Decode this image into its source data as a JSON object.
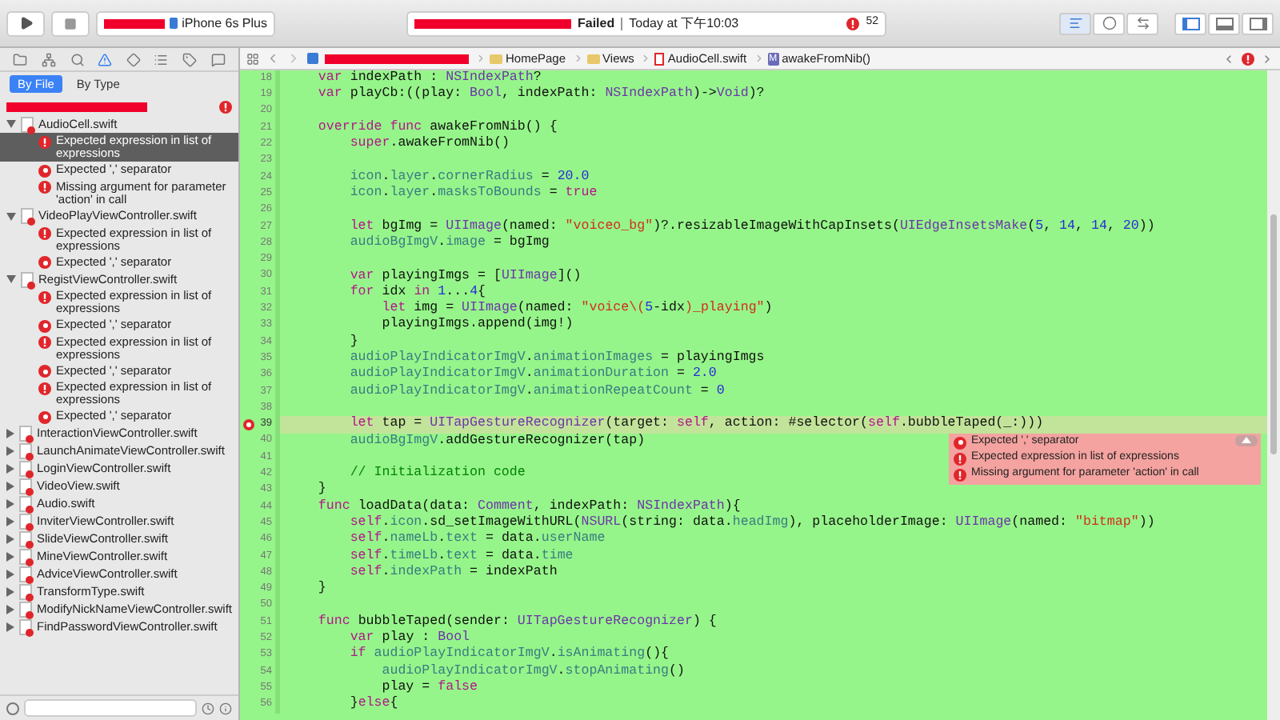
{
  "toolbar": {
    "device": "iPhone 6s Plus",
    "status": "Failed",
    "time": "Today at 下午10:03",
    "error_count": "52",
    "editor_modes": [
      {
        "selected": true
      },
      {
        "selected": false
      },
      {
        "selected": false
      }
    ],
    "panels": [
      {
        "selected": true
      },
      {
        "selected": false
      },
      {
        "selected": false
      }
    ]
  },
  "navigator": {
    "icon_tabs": [
      {
        "kind": "folder",
        "selected": false
      },
      {
        "kind": "hierarchy",
        "selected": false
      },
      {
        "kind": "search",
        "selected": false
      },
      {
        "kind": "warning",
        "selected": true
      },
      {
        "kind": "diamond",
        "selected": false
      },
      {
        "kind": "list",
        "selected": false
      },
      {
        "kind": "tag",
        "selected": false
      },
      {
        "kind": "bubble",
        "selected": false
      }
    ],
    "tabs": [
      {
        "label": "By File",
        "selected": true
      },
      {
        "label": "By Type",
        "selected": false
      }
    ],
    "files": [
      {
        "name": "AudioCell.swift",
        "expanded": true,
        "issues": [
          {
            "kind": "error",
            "text": "Expected expression in list of expressions",
            "selected": true
          },
          {
            "kind": "fixit",
            "text": "Expected ',' separator",
            "selected": false
          },
          {
            "kind": "error",
            "text": "Missing argument for parameter 'action' in call",
            "selected": false
          }
        ]
      },
      {
        "name": "VideoPlayViewController.swift",
        "expanded": true,
        "issues": [
          {
            "kind": "error",
            "text": "Expected expression in list of expressions",
            "selected": false
          },
          {
            "kind": "fixit",
            "text": "Expected ',' separator",
            "selected": false
          }
        ]
      },
      {
        "name": "RegistViewController.swift",
        "expanded": true,
        "issues": [
          {
            "kind": "error",
            "text": "Expected expression in list of expressions",
            "selected": false
          },
          {
            "kind": "fixit",
            "text": "Expected ',' separator",
            "selected": false
          },
          {
            "kind": "error",
            "text": "Expected expression in list of expressions",
            "selected": false
          },
          {
            "kind": "fixit",
            "text": "Expected ',' separator",
            "selected": false
          },
          {
            "kind": "error",
            "text": "Expected expression in list of expressions",
            "selected": false
          },
          {
            "kind": "fixit",
            "text": "Expected ',' separator",
            "selected": false
          }
        ]
      },
      {
        "name": "InteractionViewController.swift",
        "expanded": false
      },
      {
        "name": "LaunchAnimateViewController.swift",
        "expanded": false
      },
      {
        "name": "LoginViewController.swift",
        "expanded": false
      },
      {
        "name": "VideoView.swift",
        "expanded": false
      },
      {
        "name": "Audio.swift",
        "expanded": false
      },
      {
        "name": "InviterViewController.swift",
        "expanded": false
      },
      {
        "name": "SlideViewController.swift",
        "expanded": false
      },
      {
        "name": "MineViewController.swift",
        "expanded": false
      },
      {
        "name": "AdviceViewController.swift",
        "expanded": false
      },
      {
        "name": "TransformType.swift",
        "expanded": false
      },
      {
        "name": "ModifyNickNameViewController.swift",
        "expanded": false
      },
      {
        "name": "FindPasswordViewController.swift",
        "expanded": false
      }
    ]
  },
  "jump_bar": [
    {
      "kind": "folder",
      "label": "HomePage"
    },
    {
      "kind": "folder",
      "label": "Views"
    },
    {
      "kind": "file",
      "label": "AudioCell.swift"
    },
    {
      "kind": "method",
      "badge": "M",
      "label": "awakeFromNib()"
    }
  ],
  "editor": {
    "lines": [
      {
        "n": "18",
        "error": false,
        "tokens": [
          {
            "kind": "k",
            "text": "    var"
          },
          {
            "kind": "x",
            "text": " indexPath : "
          },
          {
            "kind": "t",
            "text": "NSIndexPath"
          },
          {
            "kind": "x",
            "text": "?"
          }
        ]
      },
      {
        "n": "19",
        "error": false,
        "tokens": [
          {
            "kind": "k",
            "text": "    var"
          },
          {
            "kind": "x",
            "text": " playCb:((play: "
          },
          {
            "kind": "t",
            "text": "Bool"
          },
          {
            "kind": "x",
            "text": ", indexPath: "
          },
          {
            "kind": "t",
            "text": "NSIndexPath"
          },
          {
            "kind": "x",
            "text": ")->"
          },
          {
            "kind": "t",
            "text": "Void"
          },
          {
            "kind": "x",
            "text": ")?"
          }
        ]
      },
      {
        "n": "20",
        "error": false
      },
      {
        "n": "21",
        "error": false,
        "tokens": [
          {
            "kind": "k",
            "text": "    override func"
          },
          {
            "kind": "x",
            "text": " awakeFromNib() {"
          }
        ]
      },
      {
        "n": "22",
        "error": false,
        "tokens": [
          {
            "kind": "k",
            "text": "        super"
          },
          {
            "kind": "x",
            "text": ".awakeFromNib()"
          }
        ]
      },
      {
        "n": "23",
        "error": false
      },
      {
        "n": "24",
        "error": false,
        "tokens": [
          {
            "kind": "p",
            "text": "        icon"
          },
          {
            "kind": "x",
            "text": "."
          },
          {
            "kind": "p",
            "text": "layer"
          },
          {
            "kind": "x",
            "text": "."
          },
          {
            "kind": "p",
            "text": "cornerRadius"
          },
          {
            "kind": "x",
            "text": " = "
          },
          {
            "kind": "n",
            "text": "20.0"
          }
        ]
      },
      {
        "n": "25",
        "error": false,
        "tokens": [
          {
            "kind": "p",
            "text": "        icon"
          },
          {
            "kind": "x",
            "text": "."
          },
          {
            "kind": "p",
            "text": "layer"
          },
          {
            "kind": "x",
            "text": "."
          },
          {
            "kind": "p",
            "text": "masksToBounds"
          },
          {
            "kind": "x",
            "text": " = "
          },
          {
            "kind": "k",
            "text": "true"
          }
        ]
      },
      {
        "n": "26",
        "error": false
      },
      {
        "n": "27",
        "error": false,
        "tokens": [
          {
            "kind": "k",
            "text": "        let"
          },
          {
            "kind": "x",
            "text": " bgImg = "
          },
          {
            "kind": "t",
            "text": "UIImage"
          },
          {
            "kind": "x",
            "text": "(named: "
          },
          {
            "kind": "s",
            "text": "\"voiceo_bg\""
          },
          {
            "kind": "x",
            "text": ")?.resizableImageWithCapInsets("
          },
          {
            "kind": "t",
            "text": "UIEdgeInsetsMake"
          },
          {
            "kind": "x",
            "text": "("
          },
          {
            "kind": "n",
            "text": "5"
          },
          {
            "kind": "x",
            "text": ", "
          },
          {
            "kind": "n",
            "text": "14"
          },
          {
            "kind": "x",
            "text": ", "
          },
          {
            "kind": "n",
            "text": "14"
          },
          {
            "kind": "x",
            "text": ", "
          },
          {
            "kind": "n",
            "text": "20"
          },
          {
            "kind": "x",
            "text": "))"
          }
        ]
      },
      {
        "n": "28",
        "error": false,
        "tokens": [
          {
            "kind": "p",
            "text": "        audioBgImgV"
          },
          {
            "kind": "x",
            "text": "."
          },
          {
            "kind": "p",
            "text": "image"
          },
          {
            "kind": "x",
            "text": " = bgImg"
          }
        ]
      },
      {
        "n": "29",
        "error": false
      },
      {
        "n": "30",
        "error": false,
        "tokens": [
          {
            "kind": "k",
            "text": "        var"
          },
          {
            "kind": "x",
            "text": " playingImgs = ["
          },
          {
            "kind": "t",
            "text": "UIImage"
          },
          {
            "kind": "x",
            "text": "]()"
          }
        ]
      },
      {
        "n": "31",
        "error": false,
        "tokens": [
          {
            "kind": "k",
            "text": "        for"
          },
          {
            "kind": "x",
            "text": " idx "
          },
          {
            "kind": "k",
            "text": "in"
          },
          {
            "kind": "n",
            "text": " 1"
          },
          {
            "kind": "x",
            "text": "..."
          },
          {
            "kind": "n",
            "text": "4"
          },
          {
            "kind": "x",
            "text": "{"
          }
        ]
      },
      {
        "n": "32",
        "error": false,
        "tokens": [
          {
            "kind": "k",
            "text": "            let"
          },
          {
            "kind": "x",
            "text": " img = "
          },
          {
            "kind": "t",
            "text": "UIImage"
          },
          {
            "kind": "x",
            "text": "(named: "
          },
          {
            "kind": "s",
            "text": "\"voice\\("
          },
          {
            "kind": "n",
            "text": "5"
          },
          {
            "kind": "x",
            "text": "-idx"
          },
          {
            "kind": "s",
            "text": ")_playing\""
          },
          {
            "kind": "x",
            "text": ")"
          }
        ]
      },
      {
        "n": "33",
        "error": false,
        "tokens": [
          {
            "kind": "x",
            "text": "            playingImgs.append(img!)"
          }
        ]
      },
      {
        "n": "34",
        "error": false,
        "tokens": [
          {
            "kind": "x",
            "text": "        }"
          }
        ]
      },
      {
        "n": "35",
        "error": false,
        "tokens": [
          {
            "kind": "p",
            "text": "        audioPlayIndicatorImgV"
          },
          {
            "kind": "x",
            "text": "."
          },
          {
            "kind": "p",
            "text": "animationImages"
          },
          {
            "kind": "x",
            "text": " = playingImgs"
          }
        ]
      },
      {
        "n": "36",
        "error": false,
        "tokens": [
          {
            "kind": "p",
            "text": "        audioPlayIndicatorImgV"
          },
          {
            "kind": "x",
            "text": "."
          },
          {
            "kind": "p",
            "text": "animationDuration"
          },
          {
            "kind": "x",
            "text": " = "
          },
          {
            "kind": "n",
            "text": "2.0"
          }
        ]
      },
      {
        "n": "37",
        "error": false,
        "tokens": [
          {
            "kind": "p",
            "text": "        audioPlayIndicatorImgV"
          },
          {
            "kind": "x",
            "text": "."
          },
          {
            "kind": "p",
            "text": "animationRepeatCount"
          },
          {
            "kind": "x",
            "text": " = "
          },
          {
            "kind": "n",
            "text": "0"
          }
        ]
      },
      {
        "n": "38",
        "error": false
      },
      {
        "n": "39",
        "error": true,
        "tokens": [
          {
            "kind": "k",
            "text": "        let"
          },
          {
            "kind": "x",
            "text": " tap = "
          },
          {
            "kind": "t",
            "text": "UITapGestureRecognizer"
          },
          {
            "kind": "x",
            "text": "(target: "
          },
          {
            "kind": "k",
            "text": "self"
          },
          {
            "kind": "x",
            "text": ", action: #selector("
          },
          {
            "kind": "k",
            "text": "self"
          },
          {
            "kind": "x",
            "text": ".bubbleTaped(_:)))"
          }
        ],
        "issues": [
          {
            "kind": "fixit",
            "text": "Expected ',' separator"
          },
          {
            "kind": "error",
            "text": "Expected expression in list of expressions"
          },
          {
            "kind": "error",
            "text": "Missing argument for parameter 'action' in call"
          }
        ]
      },
      {
        "n": "40",
        "error": false,
        "tokens": [
          {
            "kind": "p",
            "text": "        audioBgImgV"
          },
          {
            "kind": "x",
            "text": ".addGestureRecognizer(tap)"
          }
        ]
      },
      {
        "n": "41",
        "error": false
      },
      {
        "n": "42",
        "error": false,
        "tokens": [
          {
            "kind": "c",
            "text": "        // Initialization code"
          }
        ]
      },
      {
        "n": "43",
        "error": false,
        "tokens": [
          {
            "kind": "x",
            "text": "    }"
          }
        ]
      },
      {
        "n": "44",
        "error": false,
        "tokens": [
          {
            "kind": "k",
            "text": "    func"
          },
          {
            "kind": "x",
            "text": " loadData(data: "
          },
          {
            "kind": "t",
            "text": "Comment"
          },
          {
            "kind": "x",
            "text": ", indexPath: "
          },
          {
            "kind": "t",
            "text": "NSIndexPath"
          },
          {
            "kind": "x",
            "text": "){"
          }
        ]
      },
      {
        "n": "45",
        "error": false,
        "tokens": [
          {
            "kind": "k",
            "text": "        self"
          },
          {
            "kind": "x",
            "text": "."
          },
          {
            "kind": "p",
            "text": "icon"
          },
          {
            "kind": "x",
            "text": ".sd_setImageWithURL("
          },
          {
            "kind": "t",
            "text": "NSURL"
          },
          {
            "kind": "x",
            "text": "(string: data."
          },
          {
            "kind": "p",
            "text": "headImg"
          },
          {
            "kind": "x",
            "text": "), placeholderImage: "
          },
          {
            "kind": "t",
            "text": "UIImage"
          },
          {
            "kind": "x",
            "text": "(named: "
          },
          {
            "kind": "s",
            "text": "\"bitmap\""
          },
          {
            "kind": "x",
            "text": "))"
          }
        ]
      },
      {
        "n": "46",
        "error": false,
        "tokens": [
          {
            "kind": "k",
            "text": "        self"
          },
          {
            "kind": "x",
            "text": "."
          },
          {
            "kind": "p",
            "text": "nameLb"
          },
          {
            "kind": "x",
            "text": "."
          },
          {
            "kind": "p",
            "text": "text"
          },
          {
            "kind": "x",
            "text": " = data."
          },
          {
            "kind": "p",
            "text": "userName"
          }
        ]
      },
      {
        "n": "47",
        "error": false,
        "tokens": [
          {
            "kind": "k",
            "text": "        self"
          },
          {
            "kind": "x",
            "text": "."
          },
          {
            "kind": "p",
            "text": "timeLb"
          },
          {
            "kind": "x",
            "text": "."
          },
          {
            "kind": "p",
            "text": "text"
          },
          {
            "kind": "x",
            "text": " = data."
          },
          {
            "kind": "p",
            "text": "time"
          }
        ]
      },
      {
        "n": "48",
        "error": false,
        "tokens": [
          {
            "kind": "k",
            "text": "        self"
          },
          {
            "kind": "x",
            "text": "."
          },
          {
            "kind": "p",
            "text": "indexPath"
          },
          {
            "kind": "x",
            "text": " = indexPath"
          }
        ]
      },
      {
        "n": "49",
        "error": false,
        "tokens": [
          {
            "kind": "x",
            "text": "    }"
          }
        ]
      },
      {
        "n": "50",
        "error": false
      },
      {
        "n": "51",
        "error": false,
        "tokens": [
          {
            "kind": "k",
            "text": "    func"
          },
          {
            "kind": "x",
            "text": " bubbleTaped(sender: "
          },
          {
            "kind": "t",
            "text": "UITapGestureRecognizer"
          },
          {
            "kind": "x",
            "text": ") {"
          }
        ]
      },
      {
        "n": "52",
        "error": false,
        "tokens": [
          {
            "kind": "k",
            "text": "        var"
          },
          {
            "kind": "x",
            "text": " play : "
          },
          {
            "kind": "t",
            "text": "Bool"
          }
        ]
      },
      {
        "n": "53",
        "error": false,
        "tokens": [
          {
            "kind": "k",
            "text": "        if"
          },
          {
            "kind": "p",
            "text": " audioPlayIndicatorImgV"
          },
          {
            "kind": "x",
            "text": "."
          },
          {
            "kind": "p",
            "text": "isAnimating"
          },
          {
            "kind": "x",
            "text": "(){"
          }
        ]
      },
      {
        "n": "54",
        "error": false,
        "tokens": [
          {
            "kind": "p",
            "text": "            audioPlayIndicatorImgV"
          },
          {
            "kind": "x",
            "text": "."
          },
          {
            "kind": "p",
            "text": "stopAnimating"
          },
          {
            "kind": "x",
            "text": "()"
          }
        ]
      },
      {
        "n": "55",
        "error": false,
        "tokens": [
          {
            "kind": "x",
            "text": "            play = "
          },
          {
            "kind": "k",
            "text": "false"
          }
        ]
      },
      {
        "n": "56",
        "error": false,
        "tokens": [
          {
            "kind": "x",
            "text": "        }"
          },
          {
            "kind": "k",
            "text": "else"
          },
          {
            "kind": "x",
            "text": "{"
          }
        ]
      }
    ]
  }
}
